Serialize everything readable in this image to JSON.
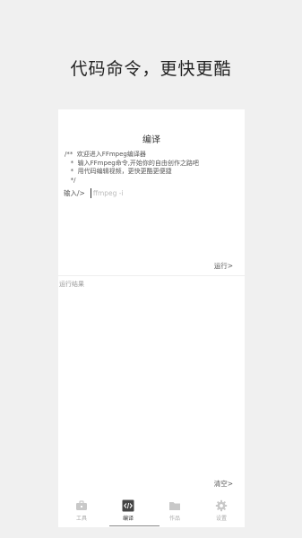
{
  "headline": "代码命令，更快更酷",
  "editor": {
    "title": "编译",
    "comment_lines": [
      "/**  欢迎进入FFmpeg编译器",
      "   *  输入FFmpeg命令,开始你的自由创作之路吧",
      "   *  用代码编辑视频，更快更酷更便捷",
      "   */"
    ],
    "input_prompt": "输入/>",
    "input_placeholder": "ffmpeg -i",
    "run_label": "运行>"
  },
  "result": {
    "label": "运行结果",
    "clear_label": "清空>"
  },
  "tabs": [
    {
      "label": "工具",
      "icon": "toolbox-icon",
      "active": false
    },
    {
      "label": "编译",
      "icon": "code-icon",
      "active": true
    },
    {
      "label": "作品",
      "icon": "folder-icon",
      "active": false
    },
    {
      "label": "设置",
      "icon": "gear-icon",
      "active": false
    }
  ],
  "colors": {
    "background": "#f0f0f0",
    "panel": "#ffffff",
    "icon_inactive": "#c8c8c8",
    "icon_active": "#444444"
  }
}
